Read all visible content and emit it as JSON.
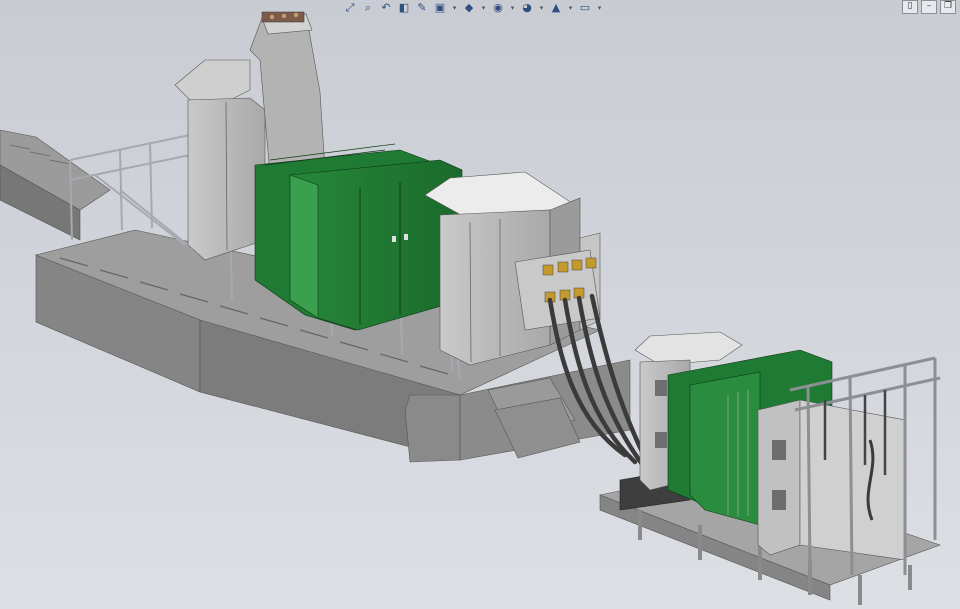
{
  "app": {
    "view": "3D model viewport"
  },
  "toolbar": {
    "buttons": [
      {
        "name": "zoom-to-fit-icon",
        "glyph": "⤢"
      },
      {
        "name": "zoom-to-area-icon",
        "glyph": "⌕"
      },
      {
        "name": "previous-view-icon",
        "glyph": "↶"
      },
      {
        "name": "section-view-icon",
        "glyph": "◧"
      },
      {
        "name": "dynamic-annotation-icon",
        "glyph": "✎"
      },
      {
        "name": "view-orientation-icon",
        "glyph": "▣"
      },
      {
        "name": "display-style-icon",
        "glyph": "◆"
      },
      {
        "name": "hide-show-items-icon",
        "glyph": "◉"
      },
      {
        "name": "edit-appearance-icon",
        "glyph": "◕"
      },
      {
        "name": "apply-scene-icon",
        "glyph": "▲"
      },
      {
        "name": "view-settings-icon",
        "glyph": "▭"
      }
    ],
    "dropdown_glyph": "▾"
  },
  "window_controls": {
    "tile": "▯",
    "minimize": "–",
    "restore": "❐"
  },
  "colors": {
    "background_top": "#c9ccd3",
    "background_bottom": "#dcdfe4",
    "concrete": "#8f8f8f",
    "concrete_dark": "#6f6f6f",
    "cabinet_gray": "#bdbdbd",
    "cabinet_green": "#1f7a33",
    "green_light": "#3aa04d",
    "railing": "#a9acb2",
    "cable": "#3b3b3b",
    "connector_gold": "#c59a2c"
  }
}
